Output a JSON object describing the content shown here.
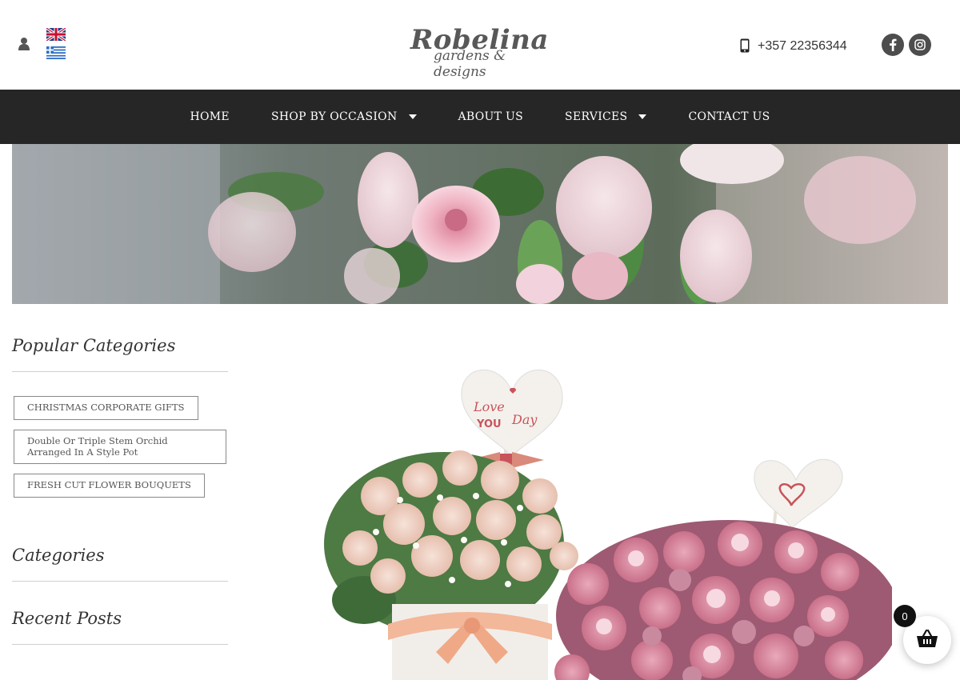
{
  "header": {
    "logo_main": "Robelina",
    "logo_sub": "gardens & designs",
    "phone": "+357 22356344",
    "languages": [
      "uk-flag-icon",
      "greek-flag-icon"
    ],
    "social": [
      "facebook-icon",
      "instagram-icon"
    ]
  },
  "nav": {
    "items": [
      {
        "label": "HOME",
        "dropdown": false
      },
      {
        "label": "SHOP BY OCCASION",
        "dropdown": true
      },
      {
        "label": "ABOUT US",
        "dropdown": false
      },
      {
        "label": "SERVICES",
        "dropdown": true
      },
      {
        "label": "CONTACT US",
        "dropdown": false
      }
    ]
  },
  "sidebar": {
    "popular_title": "Popular Categories",
    "tags": [
      "CHRISTMAS CORPORATE GIFTS",
      "Double Or Triple Stem Orchid Arranged In A Style Pot",
      "FRESH CUT FLOWER BOUQUETS"
    ],
    "categories_title": "Categories",
    "recent_title": "Recent Posts"
  },
  "product": {
    "heart_text_1": "Love",
    "heart_text_2": "YOU",
    "heart_text_3": "Day"
  },
  "cart": {
    "count": "0"
  },
  "colors": {
    "nav_bg": "#262626",
    "accent": "#4d4d4d",
    "text": "#333333"
  }
}
